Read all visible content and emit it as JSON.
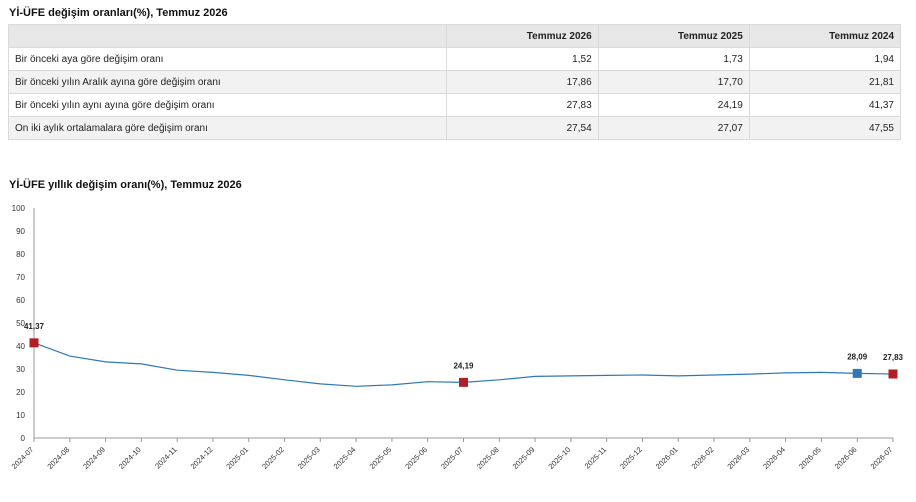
{
  "table_title": "Yİ-ÜFE değişim oranları(%), Temmuz 2026",
  "chart_title": "Yİ-ÜFE yıllık değişim oranı(%), Temmuz 2026",
  "table": {
    "headers": [
      "",
      "Temmuz 2026",
      "Temmuz 2025",
      "Temmuz 2024"
    ],
    "rows": [
      {
        "label": "Bir önceki aya göre değişim oranı",
        "values": [
          "1,52",
          "1,73",
          "1,94"
        ]
      },
      {
        "label": "Bir önceki yılın Aralık ayına göre değişim oranı",
        "values": [
          "17,86",
          "17,70",
          "21,81"
        ]
      },
      {
        "label": "Bir önceki yılın aynı ayına göre değişim oranı",
        "values": [
          "27,83",
          "24,19",
          "41,37"
        ]
      },
      {
        "label": "On iki aylık ortalamalara göre değişim oranı",
        "values": [
          "27,54",
          "27,07",
          "47,55"
        ]
      }
    ]
  },
  "colors": {
    "line": "#2e78b7",
    "highlight_red": "#b01f24",
    "highlight_blue": "#2e78b7",
    "axis": "#999999",
    "header_bg": "#e7e7e7"
  },
  "chart_data": {
    "type": "line",
    "title": "Yİ-ÜFE yıllık değişim oranı(%), Temmuz 2026",
    "xlabel": "",
    "ylabel": "",
    "ylim": [
      0,
      100
    ],
    "yticks": [
      0,
      10,
      20,
      30,
      40,
      50,
      60,
      70,
      80,
      90,
      100
    ],
    "grid": false,
    "x": [
      "2024-07",
      "2024-08",
      "2024-09",
      "2024-10",
      "2024-11",
      "2024-12",
      "2025-01",
      "2025-02",
      "2025-03",
      "2025-04",
      "2025-05",
      "2025-06",
      "2025-07",
      "2025-08",
      "2025-09",
      "2025-10",
      "2025-11",
      "2025-12",
      "2026-01",
      "2026-02",
      "2026-03",
      "2026-04",
      "2026-05",
      "2026-06",
      "2026-07"
    ],
    "series": [
      {
        "values": [
          41.37,
          35.6,
          33.1,
          32.2,
          29.5,
          28.5,
          27.2,
          25.3,
          23.5,
          22.5,
          23.1,
          24.5,
          24.19,
          25.3,
          26.8,
          27.0,
          27.2,
          27.4,
          27.0,
          27.4,
          27.8,
          28.3,
          28.5,
          28.09,
          27.83
        ]
      }
    ],
    "highlights": [
      {
        "index": 0,
        "label": "41,37",
        "color": "red"
      },
      {
        "index": 12,
        "label": "24,19",
        "color": "red"
      },
      {
        "index": 23,
        "label": "28,09",
        "color": "blue"
      },
      {
        "index": 24,
        "label": "27,83",
        "color": "red"
      }
    ]
  }
}
